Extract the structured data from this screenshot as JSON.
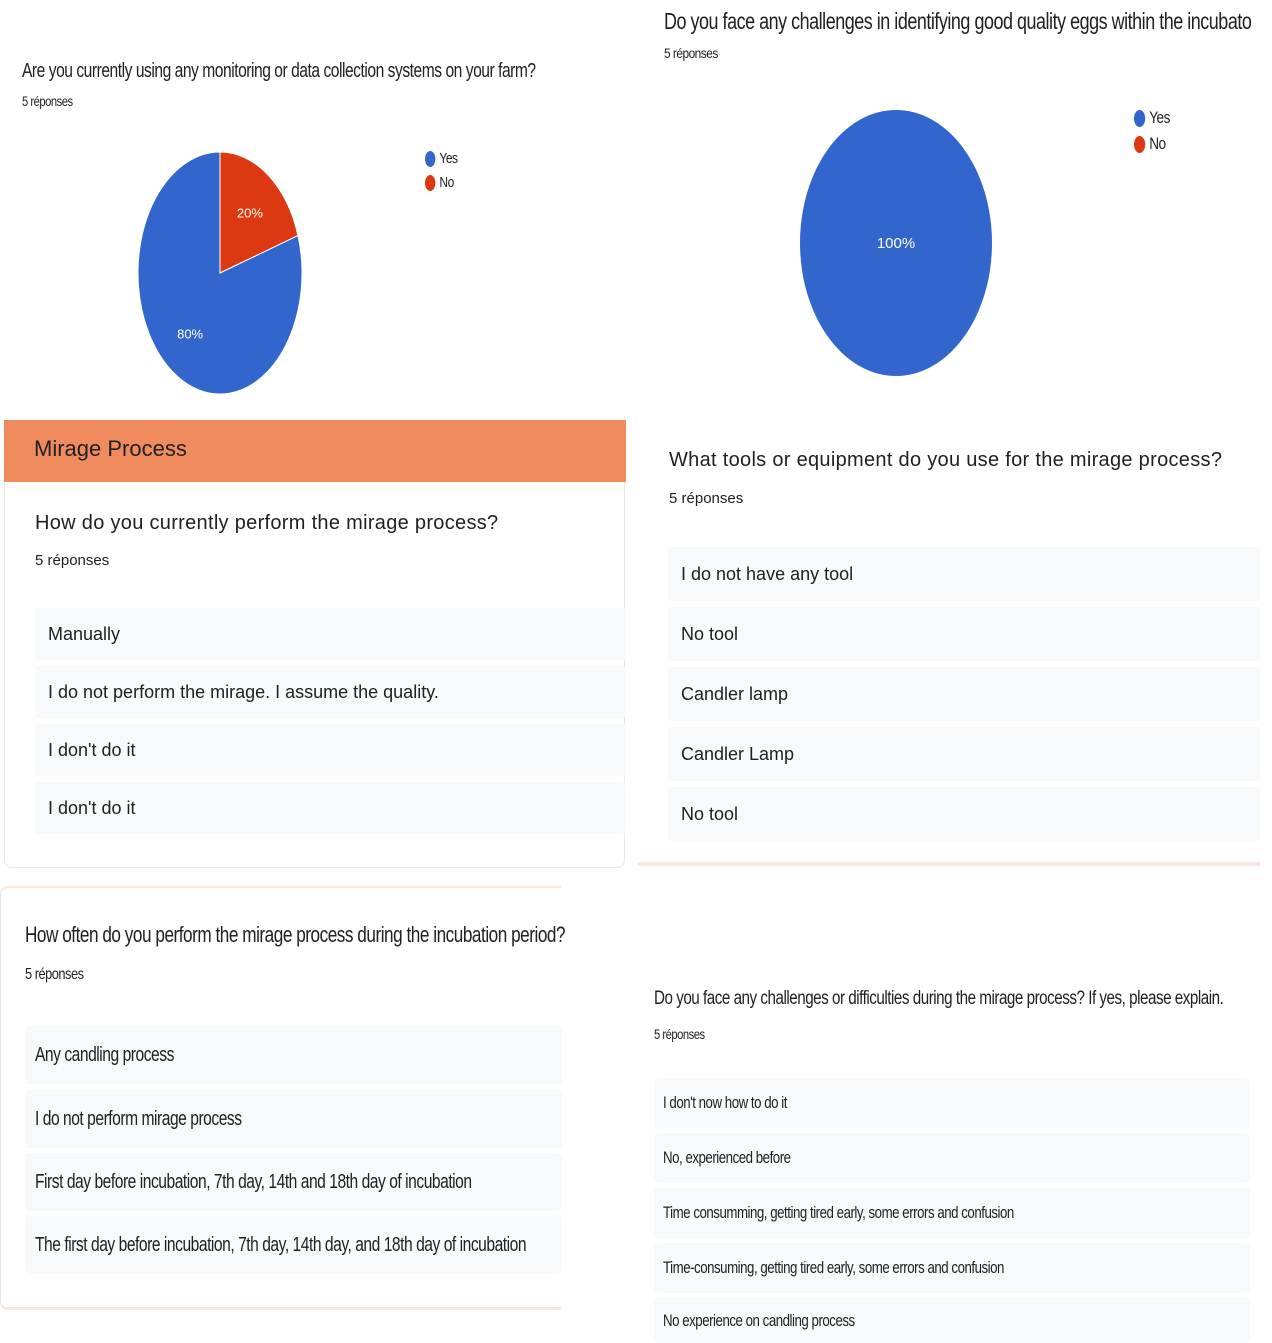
{
  "chart_data": [
    {
      "type": "pie",
      "title": "Are you currently using any monitoring or data collection systems on your farm?",
      "subtitle": "5 réponses",
      "series": [
        {
          "name": "Yes",
          "value": 80,
          "label": "80%",
          "color": "#3366cc"
        },
        {
          "name": "No",
          "value": 20,
          "label": "20%",
          "color": "#dc3912"
        }
      ],
      "legend_position": "right"
    },
    {
      "type": "pie",
      "title": "Do you face any challenges in identifying good quality eggs within the incubato",
      "subtitle": "5 réponses",
      "series": [
        {
          "name": "Yes",
          "value": 100,
          "label": "100%",
          "color": "#3366cc"
        },
        {
          "name": "No",
          "value": 0,
          "label": "",
          "color": "#dc3912"
        }
      ],
      "legend_position": "right"
    }
  ],
  "section": {
    "title": "Mirage Process",
    "header_color": "#f08b5e"
  },
  "q_perform": {
    "title": "How do you currently perform the mirage process?",
    "count": "5 réponses",
    "responses": [
      "Manually",
      "I do not perform the mirage. I assume the quality.",
      "I don't do it",
      "I don't do it"
    ]
  },
  "q_tools": {
    "title": "What tools or equipment do you use for the mirage process?",
    "count": "5 réponses",
    "responses": [
      "I do not have any tool",
      "No tool",
      "Candler lamp",
      "Candler Lamp",
      "No tool"
    ]
  },
  "q_often": {
    "title": "How often do you perform the mirage process during the incubation period?",
    "count": "5 réponses",
    "responses": [
      "Any candling process",
      "I do not perform mirage process",
      "First day before incubation, 7th day, 14th and 18th day of incubation",
      "The first day before incubation, 7th day, 14th day, and 18th day of incubation"
    ]
  },
  "q_challenges": {
    "title": "Do you face any challenges or difficulties during the mirage process? If yes, please explain.",
    "count": "5 réponses",
    "responses": [
      "I don't now how to do it",
      "No, experienced before",
      "Time consumming, getting tired early, some errors and confusion",
      "Time-consuming, getting tired early, some errors and confusion",
      "No experience on candling process"
    ]
  }
}
